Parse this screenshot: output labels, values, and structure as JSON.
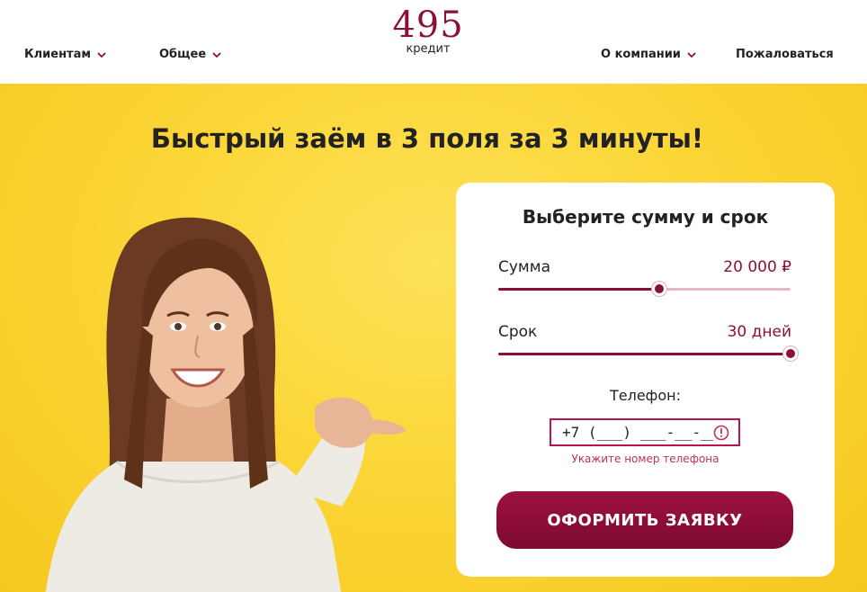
{
  "header": {
    "nav_left": [
      {
        "label": "Клиентам",
        "icon": "chevron-down-icon"
      },
      {
        "label": "Общее",
        "icon": "chevron-down-icon"
      }
    ],
    "nav_right": [
      {
        "label": "О компании",
        "icon": "chevron-down-icon"
      },
      {
        "label": "Пожаловаться"
      }
    ],
    "logo": {
      "number": "495",
      "subtitle": "кредит"
    }
  },
  "hero": {
    "title": "Быстрый заём в 3 поля за 3 минуты!"
  },
  "form": {
    "title": "Выберите сумму и срок",
    "amount": {
      "label": "Сумма",
      "value": "20 000 ₽",
      "slider_fraction": 0.55
    },
    "term": {
      "label": "Срок",
      "value": "30 дней",
      "slider_fraction": 1.0
    },
    "phone": {
      "label": "Телефон:",
      "value": "+7 (___) ___-__-__",
      "error": "Укажите номер телефона",
      "error_icon": "warning-circle-icon"
    },
    "submit_label": "ОФОРМИТЬ ЗАЯВКУ"
  },
  "colors": {
    "brand": "#8b1035",
    "hero_yellow": "#fbd637",
    "slider_rest": "#e6b7c5",
    "error": "#c0334e"
  }
}
